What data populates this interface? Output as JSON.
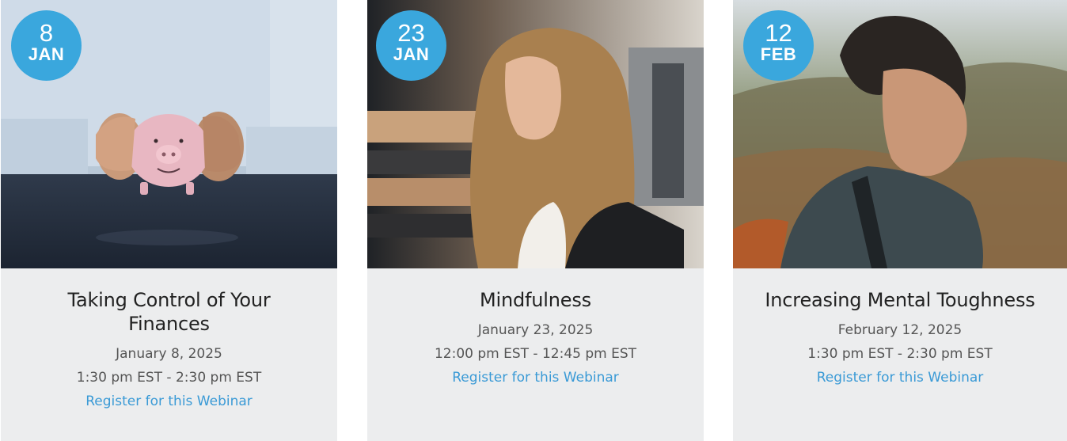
{
  "webinars": [
    {
      "day": "8",
      "month": "JAN",
      "title": "Taking Control of Your Finances",
      "date": "January 8, 2025",
      "time": "1:30 pm EST - 2:30 pm EST",
      "register_label": "Register for this Webinar"
    },
    {
      "day": "23",
      "month": "JAN",
      "title": "Mindfulness",
      "date": "January 23, 2025",
      "time": "12:00 pm EST - 12:45 pm EST",
      "register_label": "Register for this Webinar"
    },
    {
      "day": "12",
      "month": "FEB",
      "title": "Increasing Mental Toughness",
      "date": "February 12, 2025",
      "time": "1:30 pm EST - 2:30 pm EST",
      "register_label": "Register for this Webinar"
    }
  ],
  "colors": {
    "badge": "#3aa7dd",
    "card_background": "#ecedee",
    "link": "#3a9ad6",
    "title_text": "#222222",
    "meta_text": "#555555"
  }
}
